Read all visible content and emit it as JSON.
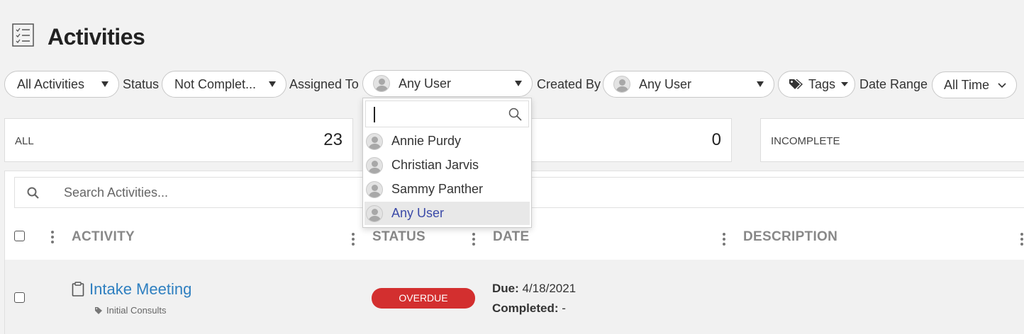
{
  "page": {
    "title": "Activities",
    "icon": "checklist-icon"
  },
  "filters": {
    "activity_type": {
      "value": "All Activities"
    },
    "status": {
      "label": "Status",
      "value": "Not Complet..."
    },
    "assigned_to": {
      "label": "Assigned To",
      "value": "Any User"
    },
    "created_by": {
      "label": "Created By",
      "value": "Any User"
    },
    "tags": {
      "value": "Tags"
    },
    "date_range": {
      "label": "Date Range",
      "value": "All Time"
    }
  },
  "assigned_dropdown": {
    "search_value": "",
    "options": [
      {
        "name": "Annie Purdy",
        "selected": false
      },
      {
        "name": "Christian Jarvis",
        "selected": false
      },
      {
        "name": "Sammy Panther",
        "selected": false
      },
      {
        "name": "Any User",
        "selected": true
      }
    ]
  },
  "summary_cards": [
    {
      "label": "ALL",
      "count": "23"
    },
    {
      "label": "",
      "count": "0"
    },
    {
      "label": "INCOMPLETE",
      "count": ""
    }
  ],
  "search": {
    "placeholder": "Search Activities..."
  },
  "table": {
    "columns": [
      "ACTIVITY",
      "STATUS",
      "DATE",
      "DESCRIPTION"
    ],
    "rows": [
      {
        "activity": "Intake Meeting",
        "tag": "Initial Consults",
        "status": "OVERDUE",
        "due_label": "Due:",
        "due": " 4/18/2021",
        "completed_label": "Completed:",
        "completed": " -",
        "description": ""
      }
    ]
  },
  "colors": {
    "accent_link": "#2e7fc0",
    "overdue": "#d32f2f",
    "selected_option_text": "#3b4aa8"
  }
}
